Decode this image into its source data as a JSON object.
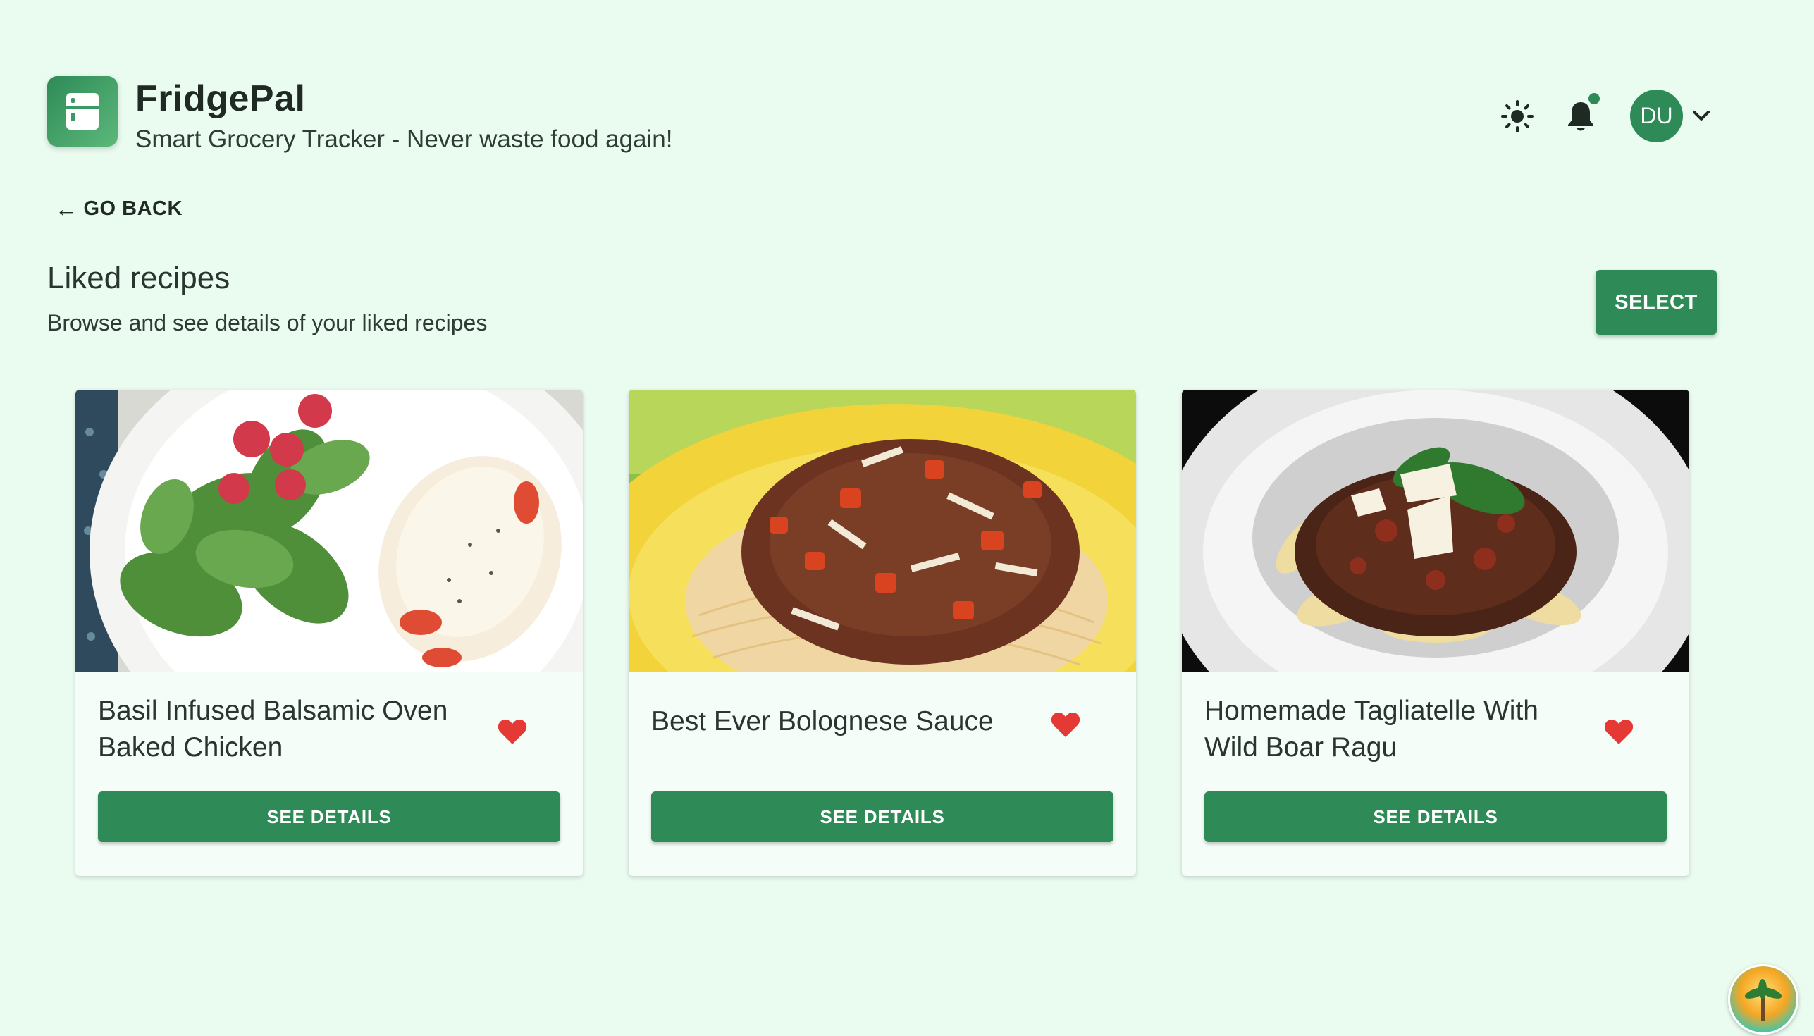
{
  "app": {
    "title": "FridgePal",
    "subtitle": "Smart Grocery Tracker - Never waste food again!"
  },
  "header": {
    "theme_icon": "sun-icon",
    "notification_icon": "bell-icon",
    "user_initials": "DU",
    "menu_icon": "chevron-down-icon"
  },
  "nav": {
    "back_label": "GO BACK"
  },
  "section": {
    "title": "Liked recipes",
    "description": "Browse and see details of your liked recipes",
    "select_label": "SELECT"
  },
  "recipes": [
    {
      "title": "Basil Infused Balsamic Oven Baked Chicken",
      "liked": true,
      "button_label": "SEE DETAILS"
    },
    {
      "title": "Best Ever Bolognese Sauce",
      "liked": true,
      "button_label": "SEE DETAILS"
    },
    {
      "title": "Homemade Tagliatelle With Wild Boar Ragu",
      "liked": true,
      "button_label": "SEE DETAILS"
    }
  ],
  "colors": {
    "primary": "#2e8b57",
    "background": "#eafbf0",
    "heart": "#e53935"
  }
}
